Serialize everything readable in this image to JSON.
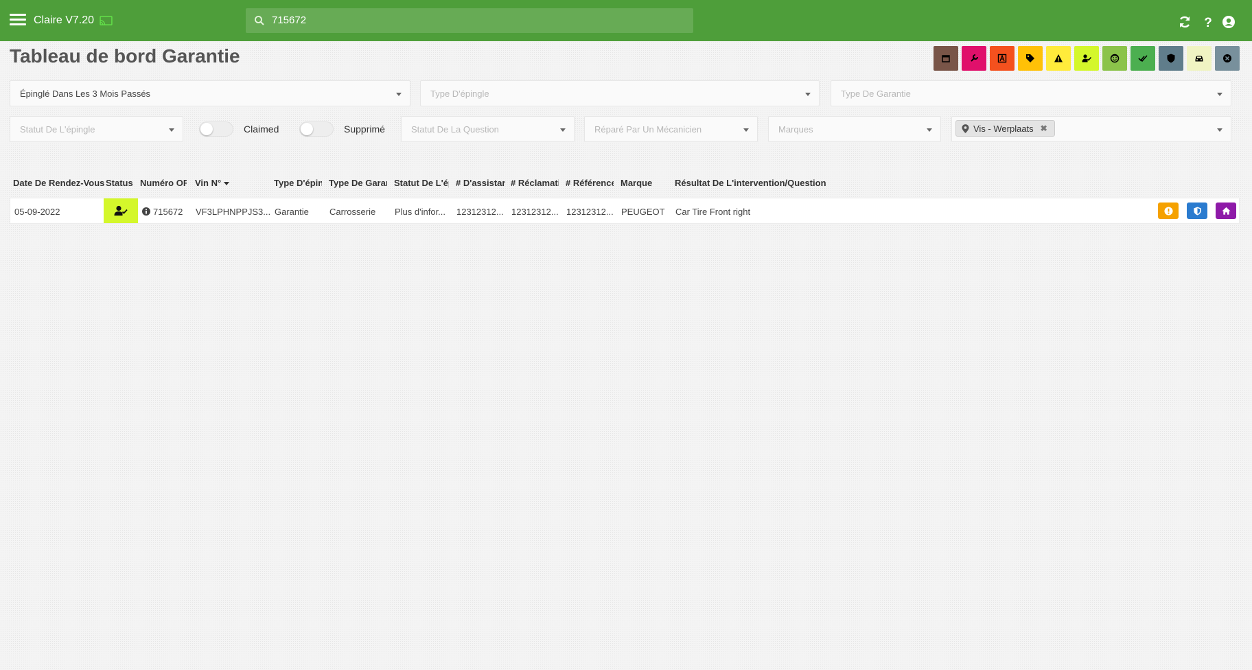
{
  "app": {
    "title": "Claire V7.20"
  },
  "search": {
    "value": "715672"
  },
  "page": {
    "title": "Tableau de bord Garantie"
  },
  "legend": [
    {
      "name": "calendar-icon",
      "color": "#795548"
    },
    {
      "name": "wrench-icon",
      "color": "#e0106b"
    },
    {
      "name": "letter-a-icon",
      "color": "#f4511e"
    },
    {
      "name": "tag-icon",
      "color": "#ffc107"
    },
    {
      "name": "warning-icon",
      "color": "#ffeb3b"
    },
    {
      "name": "user-check-icon",
      "color": "#d4f72b"
    },
    {
      "name": "face-icon",
      "color": "#8bc34a"
    },
    {
      "name": "double-check-icon",
      "color": "#4caf50"
    },
    {
      "name": "shield-icon",
      "color": "#607d8b"
    },
    {
      "name": "car-icon",
      "color": "#f0f4c3"
    },
    {
      "name": "cancel-circle-icon",
      "color": "#78909c"
    }
  ],
  "filters": {
    "period": "Épinglé Dans Les 3 Mois Passés",
    "pin_type": "Type D'épingle",
    "warranty_type": "Type De Garantie",
    "pin_status": "Statut De L'épingle",
    "claimed_label": "Claimed",
    "deleted_label": "Supprimé",
    "question_status": "Statut De La Question",
    "repaired_by": "Réparé Par Un Mécanicien",
    "brands": "Marques",
    "location_chip": "Vis - Werplaats"
  },
  "table": {
    "headers": {
      "date": "Date De Rendez-Vous",
      "status": "Status",
      "or_number": "Numéro OR",
      "vin": "Vin N°",
      "pin_type": "Type D'épingle",
      "warranty_type": "Type De Garantie",
      "pin_status": "Statut De L'épingle",
      "assistance": "# D'assistance",
      "claim": "# Réclamation",
      "reference": "# Référence",
      "brand": "Marque",
      "result": "Résultat De L'intervention/Question"
    },
    "rows": [
      {
        "date": "05-09-2022",
        "or_number": "715672",
        "vin": "VF3LPHNPPJS3...",
        "pin_type": "Garantie",
        "warranty_type": "Carrosserie",
        "pin_status": "Plus d'infor...",
        "assistance": "12312312...",
        "claim": "12312312...",
        "reference": "12312312...",
        "brand": "PEUGEOT",
        "result": "Car Tire Front right"
      }
    ]
  },
  "colors": {
    "topbar": "#4e9e3a",
    "status_bg": "#d4f72b",
    "action_warning": "#f5a100",
    "action_shield": "#2a7bcf",
    "action_home": "#8e1aa8"
  }
}
